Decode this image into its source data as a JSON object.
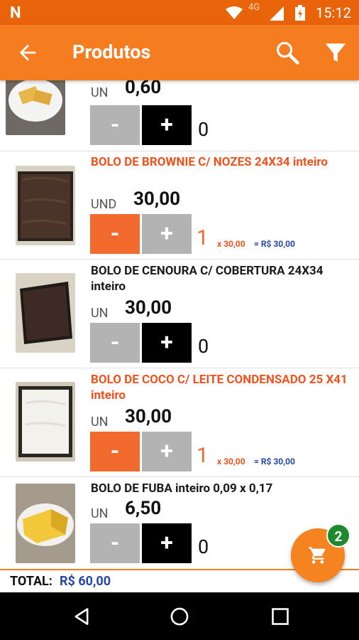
{
  "status_bar": {
    "network": "4G",
    "time": "15:12"
  },
  "app_bar": {
    "title": "Produtos"
  },
  "products": [
    {
      "name": "",
      "unit": "UN",
      "price": "0,60",
      "quantity": "0"
    },
    {
      "name": "BOLO DE BROWNIE C/ NOZES 24X34 inteiro",
      "unit": "UND",
      "price": "30,00",
      "quantity": "1",
      "multiplier": "x 30,00",
      "subtotal": "= R$ 30,00"
    },
    {
      "name": "BOLO DE CENOURA C/ COBERTURA 24X34 inteiro",
      "unit": "UN",
      "price": "30,00",
      "quantity": "0"
    },
    {
      "name": "BOLO DE COCO C/ LEITE CONDENSADO 25 X41 inteiro",
      "unit": "UN",
      "price": "30,00",
      "quantity": "1",
      "multiplier": "x 30,00",
      "subtotal": "= R$ 30,00"
    },
    {
      "name": "BOLO DE FUBA inteiro 0,09 x 0,17",
      "unit": "UN",
      "price": "6,50",
      "quantity": "0"
    }
  ],
  "buttons": {
    "minus": "-",
    "plus": "+"
  },
  "total": {
    "label": "TOTAL:",
    "value": "R$ 60,00"
  },
  "cart": {
    "badge": "2"
  },
  "colors": {
    "primary": "#f57c1f",
    "accent_red": "#f0521e",
    "price_blue": "#2346a8",
    "badge_green": "#1e8a2e"
  },
  "icons": [
    "back-arrow-icon",
    "search-icon",
    "filter-icon",
    "cart-icon",
    "nav-back-icon",
    "nav-home-icon",
    "nav-recents-icon",
    "wifi-icon",
    "signal-icon",
    "battery-icon"
  ]
}
